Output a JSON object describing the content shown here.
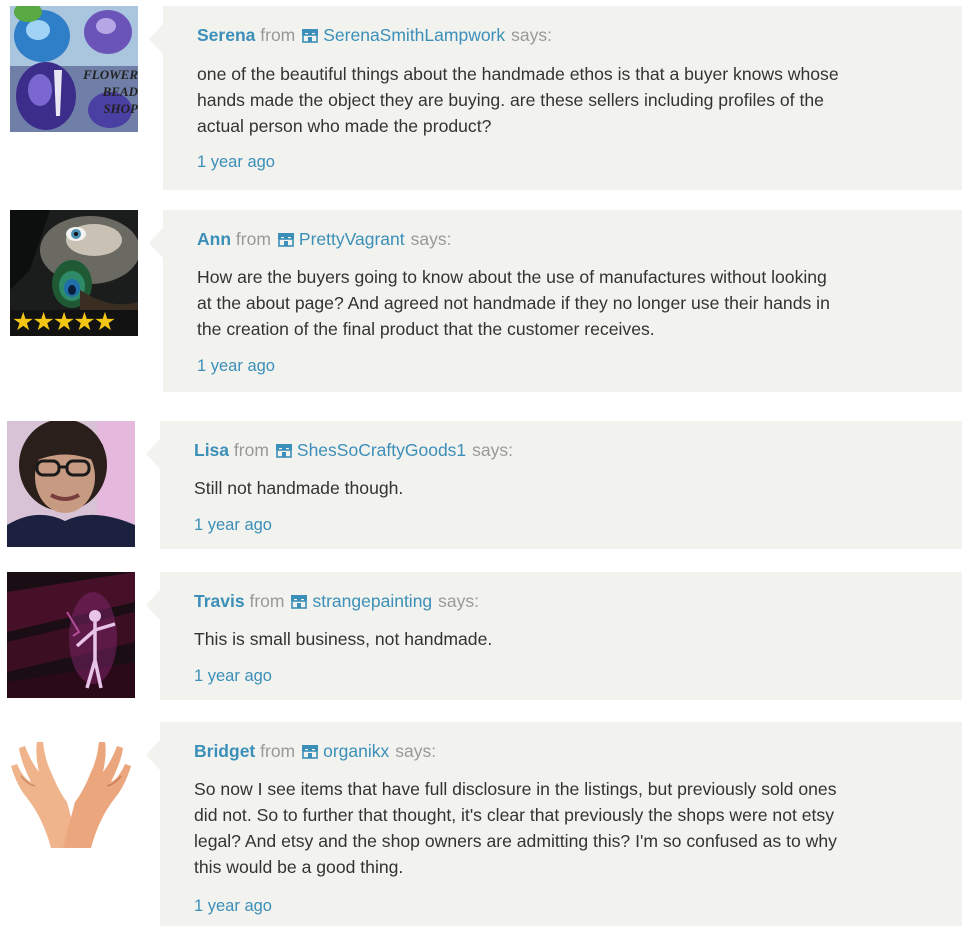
{
  "comments": [
    {
      "name": "Serena",
      "from": "from",
      "shop_icon": "shop-icon",
      "shop": "SerenaSmithLampwork",
      "says": "says:",
      "lines": [
        "one of the beautiful things about the handmade ethos is that a buyer knows whose",
        "hands made the object they are buying. are these sellers including profiles of the",
        "actual person who made the product?"
      ],
      "time": "1 year ago",
      "avatar": {
        "label_lines": [
          "FLOWER",
          "BEAD",
          "SHOP"
        ]
      }
    },
    {
      "name": "Ann",
      "from": "from",
      "shop_icon": "shop-icon",
      "shop": "PrettyVagrant",
      "says": "says:",
      "lines": [
        "How are the buyers going to know about the use of manufactures without looking",
        "at the about page? And agreed not handmade if they no longer use their hands in",
        "the creation of the final product that the customer receives."
      ],
      "time": "1 year ago",
      "avatar": {
        "stars": 5
      }
    },
    {
      "name": "Lisa",
      "from": "from",
      "shop_icon": "shop-icon",
      "shop": "ShesSoCraftyGoods1",
      "says": "says:",
      "lines": [
        "Still not handmade though."
      ],
      "time": "1 year ago",
      "avatar": {}
    },
    {
      "name": "Travis",
      "from": "from",
      "shop_icon": "shop-icon",
      "shop": "strangepainting",
      "says": "says:",
      "lines": [
        "This is small business, not handmade."
      ],
      "time": "1 year ago",
      "avatar": {}
    },
    {
      "name": "Bridget",
      "from": "from",
      "shop_icon": "shop-icon",
      "shop": "organikx",
      "says": "says:",
      "lines": [
        "So now I see items that have full disclosure in the listings, but previously sold ones",
        "did not. So to further that thought, it's clear that previously the shops were not etsy",
        "legal? And etsy and the shop owners are admitting this? I'm so confused as to why",
        "this would be a good thing."
      ],
      "time": "1 year ago",
      "avatar": {}
    }
  ],
  "colors": {
    "link": "#3b8fb8",
    "muted": "#999999",
    "text": "#333333",
    "bubble": "#f2f2ef"
  }
}
